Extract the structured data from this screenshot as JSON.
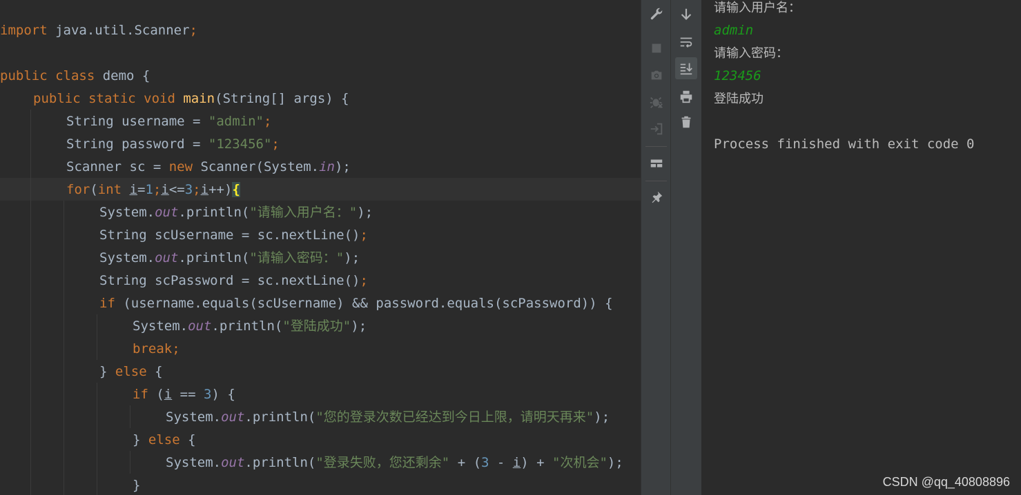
{
  "editor": {
    "line1": {
      "kw": "import",
      "rest": " java.util.Scanner",
      "semi": ";"
    },
    "line2": {
      "kw1": "public",
      "kw2": "class",
      "name": " demo {"
    },
    "line3": {
      "kw": "public static void",
      "fn": "main",
      "rest": "(String[] args) {"
    },
    "line4": {
      "pre": "String username = ",
      "str": "\"admin\"",
      "semi": ";"
    },
    "line5": {
      "pre": "String password = ",
      "str": "\"123456\"",
      "semi": ";"
    },
    "line6": {
      "pre": "Scanner sc = ",
      "kw": "new",
      "mid": " Scanner(System.",
      "fld": "in",
      "end": ");"
    },
    "line7": {
      "kw_for": "for",
      "p1": "(",
      "kw_int": "int",
      "v1": "i",
      "n1": "1",
      "v2": "i",
      "op": "<=",
      "n2": "3",
      "v3": "i",
      "inc": "++)",
      "brace": "{"
    },
    "line8": {
      "pre": "System.",
      "fld": "out",
      "mid": ".println(",
      "str": "\"请输入用户名：\"",
      "end": ");"
    },
    "line9": {
      "pre": "String scUsername = sc.nextLine()",
      "semi": ";"
    },
    "line10": {
      "pre": "System.",
      "fld": "out",
      "mid": ".println(",
      "str": "\"请输入密码：\"",
      "end": ");"
    },
    "line11": {
      "pre": "String scPassword = sc.nextLine()",
      "semi": ";"
    },
    "line12": {
      "kw": "if",
      "rest": " (username.equals(scUsername) && password.equals(scPassword)) {"
    },
    "line13": {
      "pre": "System.",
      "fld": "out",
      "mid": ".println(",
      "str": "\"登陆成功\"",
      "end": ");"
    },
    "line14": {
      "kw": "break",
      "semi": ";"
    },
    "line15": {
      "pre": "} ",
      "kw": "else",
      "rest": " {"
    },
    "line16": {
      "kw": "if",
      "p1": " (",
      "v": "i",
      "op": " == ",
      "n": "3",
      "rest": ") {"
    },
    "line17": {
      "pre": "System.",
      "fld": "out",
      "mid": ".println(",
      "str": "\"您的登录次数已经达到今日上限，请明天再来\"",
      "end": ");"
    },
    "line18": {
      "pre": "} ",
      "kw": "else",
      "rest": " {"
    },
    "line19": {
      "pre": "System.",
      "fld": "out",
      "mid": ".println(",
      "str1": "\"登录失败，您还剩余\"",
      "op1": " + (",
      "n": "3",
      "op2": " - ",
      "v": "i",
      "op3": ") + ",
      "str2": "\"次机会\"",
      "end": ");"
    },
    "line20": {
      "text": "}"
    }
  },
  "tools": {
    "left": [
      "wrench-icon",
      "stop-icon",
      "camera-icon",
      "debug-icon",
      "login-icon",
      "layout-icon",
      "pin-icon"
    ],
    "right": [
      "arrow-down-icon",
      "soft-wrap-icon",
      "scroll-to-end-icon",
      "print-icon",
      "trash-icon"
    ]
  },
  "console": {
    "prompt_user": "请输入用户名：",
    "input_user": "admin",
    "prompt_pass": "请输入密码：",
    "input_pass": "123456",
    "result": "登陆成功",
    "exit": "Process finished with exit code 0"
  },
  "watermark": "CSDN @qq_40808896",
  "colors": {
    "background": "#2b2b2b",
    "keyword": "#cc7832",
    "string": "#6a8759",
    "number": "#6897bb",
    "field": "#9876aa",
    "method": "#ffc66d",
    "console_input": "#1a9b1a"
  }
}
